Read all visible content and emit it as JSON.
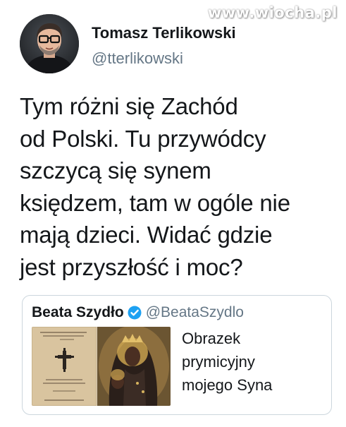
{
  "watermark": "www.wiocha.pl",
  "tweet": {
    "author": {
      "name": "Tomasz Terlikowski",
      "handle": "@tterlikowski"
    },
    "text": "Tym różni się Zachód\nod Polski. Tu przywódcy\nszczycą się synem\nksiędzem, tam w ogóle nie\nmają dzieci. Widać gdzie\njest przyszłość i moc?"
  },
  "quoted_tweet": {
    "author": {
      "name": "Beata Szydło",
      "handle": "@BeataSzydlo",
      "verified": true
    },
    "text": "Obrazek\nprymicyjny\nmojego Syna",
    "image": {
      "card_caption": "Ku pamięci wspaniałych nas Chrystus",
      "card_verse": "Mojej Kapłaństwa Chrystusowego",
      "card_footer": "Ks. Tymoteusz Szydło"
    }
  },
  "colors": {
    "text": "#14171a",
    "secondary": "#657786",
    "border": "#ccd6dd",
    "verified": "#1da1f2"
  }
}
